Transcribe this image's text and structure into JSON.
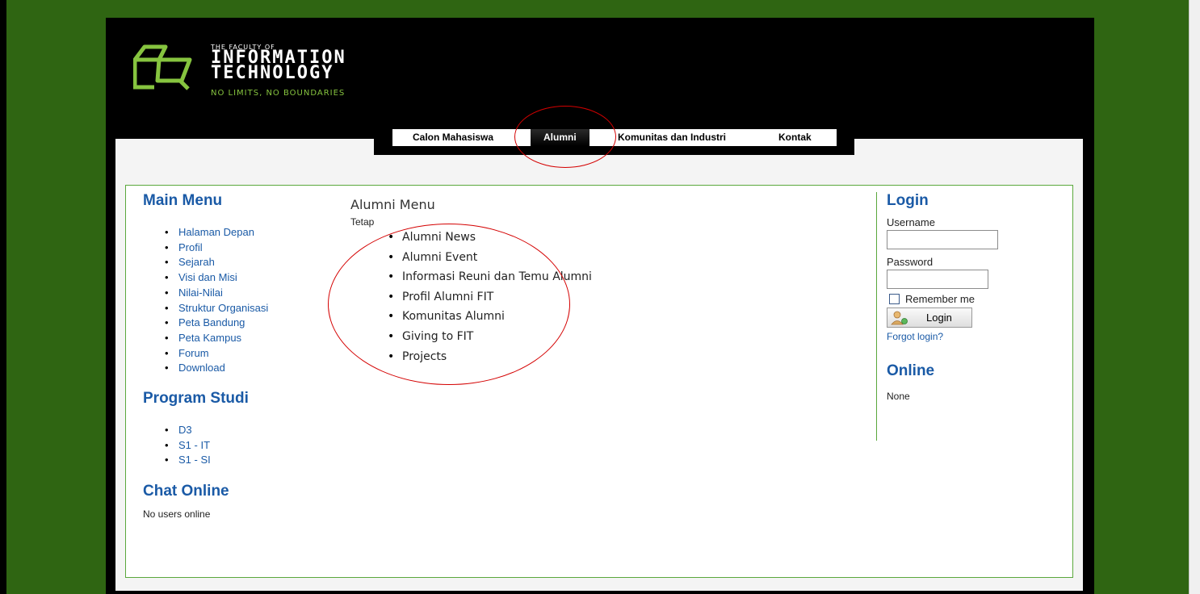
{
  "header": {
    "logo_small": "THE FACULTY OF",
    "logo_line1": "INFORMATION",
    "logo_line2": "TECHNOLOGY",
    "tagline": "NO LIMITS, NO BOUNDARIES"
  },
  "nav": {
    "items": [
      {
        "label": "Calon Mahasiswa"
      },
      {
        "label": "Alumni"
      },
      {
        "label": "Komunitas dan Industri"
      },
      {
        "label": "Kontak"
      }
    ]
  },
  "main_menu": {
    "title": "Main Menu",
    "items": [
      "Halaman Depan",
      "Profil",
      "Sejarah",
      "Visi dan Misi",
      "Nilai-Nilai",
      "Struktur Organisasi",
      "Peta Bandung",
      "Peta Kampus",
      "Forum",
      "Download"
    ]
  },
  "program_studi": {
    "title": "Program Studi",
    "items": [
      "D3",
      "S1 - IT",
      "S1 - SI"
    ]
  },
  "chat_online": {
    "title": "Chat Online",
    "status": "No users online"
  },
  "alumni_menu": {
    "title": "Alumni Menu",
    "subtitle": "Tetap",
    "items": [
      "Alumni News",
      "Alumni Event",
      "Informasi Reuni dan Temu Alumni",
      "Profil Alumni FIT",
      "Komunitas Alumni",
      "Giving to FIT",
      "Projects"
    ]
  },
  "login": {
    "title": "Login",
    "username_label": "Username",
    "password_label": "Password",
    "remember_label": "Remember me",
    "button_label": "Login",
    "forgot_label": "Forgot login?"
  },
  "online": {
    "title": "Online",
    "status": "None"
  },
  "colors": {
    "background": "#2f6512",
    "link": "#1a5aa6",
    "border": "#5aa83c",
    "accent": "#86c43f",
    "annotation": "#d40000"
  }
}
